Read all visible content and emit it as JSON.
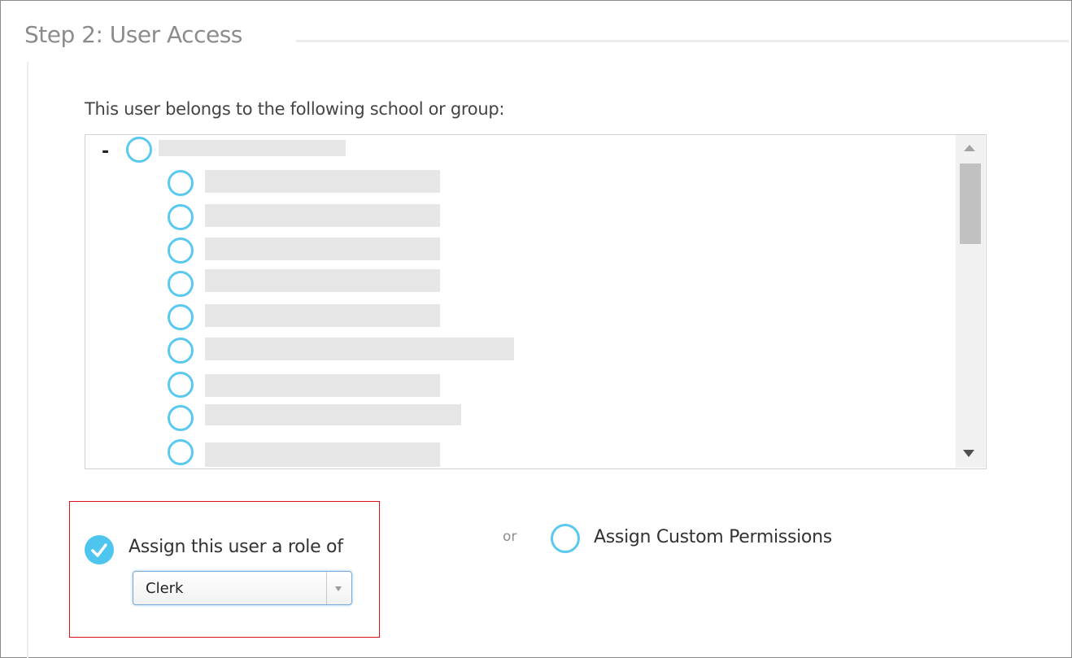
{
  "section": {
    "title": "Step 2: User Access"
  },
  "tree": {
    "heading": "This user belongs to the following school or group:",
    "collapse_symbol": "-",
    "root": {
      "label": ""
    },
    "children": [
      {
        "label": ""
      },
      {
        "label": ""
      },
      {
        "label": ""
      },
      {
        "label": ""
      },
      {
        "label": ""
      },
      {
        "label": ""
      },
      {
        "label": ""
      },
      {
        "label": ""
      },
      {
        "label": ""
      }
    ]
  },
  "role_option": {
    "label": "Assign this user a role of",
    "selected": true,
    "select_value": "Clerk"
  },
  "separator": "or",
  "custom_option": {
    "label": "Assign Custom Permissions",
    "selected": false
  },
  "colors": {
    "accent": "#4dc5ee",
    "highlight_border": "#d9141b",
    "title_gray": "#8c8c8c"
  },
  "icons": [
    "minus-icon",
    "radio-icon",
    "check-icon",
    "scroll-up-icon",
    "scroll-down-icon",
    "dropdown-arrow-icon"
  ]
}
